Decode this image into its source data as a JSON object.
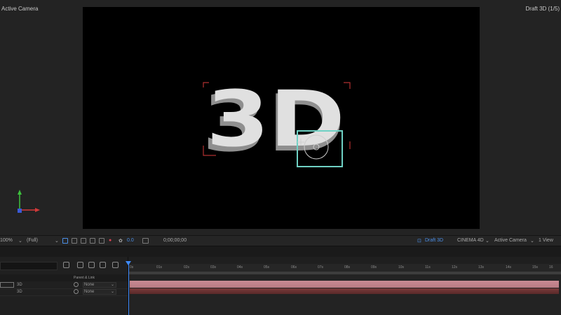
{
  "viewer": {
    "view_label": "Active Camera",
    "renderer_label": "Draft 3D (1/5)",
    "text_3d": "3D"
  },
  "viewer_bar": {
    "zoom": "100%",
    "resolution": "(Full)",
    "exposure": "0.0",
    "timecode": "0;00;00;00",
    "draft_3d": "Draft 3D",
    "renderer": "CINEMA 4D",
    "camera": "Active Camera",
    "views": "1 View"
  },
  "timeline": {
    "parent_header": "Parent & Link",
    "ruler_ticks": [
      "0s",
      "01s",
      "02s",
      "03s",
      "04s",
      "05s",
      "06s",
      "07s",
      "08s",
      "09s",
      "10s",
      "11s",
      "12s",
      "13s",
      "14s",
      "15s",
      "16"
    ],
    "layers": [
      {
        "name": "3D",
        "parent": "None"
      },
      {
        "name": "3D",
        "parent": "None"
      }
    ]
  },
  "colors": {
    "selection": "#6fd1c4",
    "accent_blue": "#3f8cff",
    "layer_bar": "#c98a93"
  }
}
